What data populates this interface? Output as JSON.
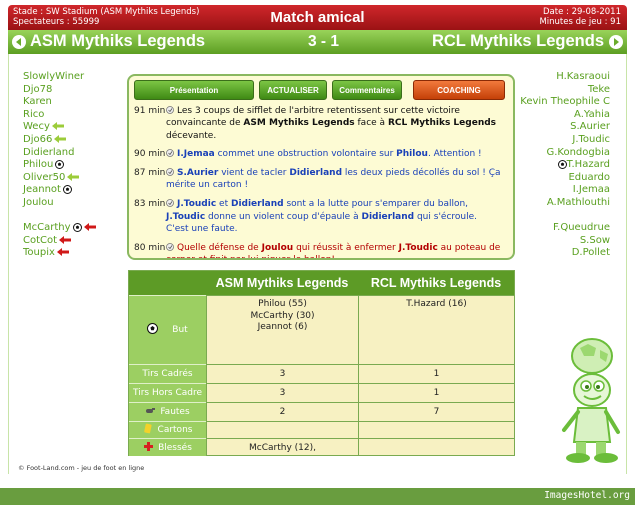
{
  "header": {
    "stadium": "Stade : SW Stadium (ASM Mythiks Legends)",
    "spectators": "Spectateurs : 55999",
    "title": "Match amical",
    "date": "Date : 29-08-2011",
    "minutes": "Minutes de jeu : 91"
  },
  "teams": {
    "home": "ASM Mythiks Legends",
    "away": "RCL Mythiks Legends",
    "score": "3 - 1"
  },
  "home_roster": [
    {
      "name": "SlowlyWiner",
      "marker": ""
    },
    {
      "name": "Djo78",
      "marker": ""
    },
    {
      "name": "Karen",
      "marker": ""
    },
    {
      "name": "Rico",
      "marker": ""
    },
    {
      "name": "Wecy",
      "marker": "sub-in"
    },
    {
      "name": "Djo66",
      "marker": "sub-in"
    },
    {
      "name": "Didierland",
      "marker": ""
    },
    {
      "name": "Philou",
      "marker": "goal"
    },
    {
      "name": "Oliver50",
      "marker": "sub-in"
    },
    {
      "name": "Jeannot",
      "marker": "goal"
    },
    {
      "name": "Joulou",
      "marker": ""
    },
    {
      "name": "",
      "marker": ""
    },
    {
      "name": "McCarthy",
      "marker": "goal-sub-out"
    },
    {
      "name": "CotCot",
      "marker": "sub-out"
    },
    {
      "name": "Toupix",
      "marker": "sub-out"
    }
  ],
  "away_roster": [
    {
      "name": "H.Kasraoui",
      "marker": ""
    },
    {
      "name": "Teke",
      "marker": ""
    },
    {
      "name": "Kevin Theophile C",
      "marker": ""
    },
    {
      "name": "A.Yahia",
      "marker": ""
    },
    {
      "name": "S.Aurier",
      "marker": ""
    },
    {
      "name": "J.Toudic",
      "marker": ""
    },
    {
      "name": "G.Kondogbia",
      "marker": ""
    },
    {
      "name": "T.Hazard",
      "marker": "goal"
    },
    {
      "name": "Eduardo",
      "marker": ""
    },
    {
      "name": "I.Jemaa",
      "marker": ""
    },
    {
      "name": "A.Mathlouthi",
      "marker": ""
    },
    {
      "name": "",
      "marker": ""
    },
    {
      "name": "F.Queudrue",
      "marker": ""
    },
    {
      "name": "S.Sow",
      "marker": ""
    },
    {
      "name": "D.Pollet",
      "marker": ""
    }
  ],
  "tabs": {
    "presentation": "Présentation",
    "refresh": "ACTUALISER",
    "comments": "Commentaires",
    "coaching": "COACHING"
  },
  "events": [
    {
      "minute": "91 min",
      "l1": [
        [
          "t-blk",
          "Les 3 coups de sifflet de l'arbitre retentissent sur cette victoire"
        ]
      ],
      "l2": [
        [
          "t-blk",
          "convaincante de "
        ],
        [
          "t-blk b",
          "ASM Mythiks Legends"
        ],
        [
          "t-blk",
          " face à "
        ],
        [
          "t-blk b",
          "RCL Mythiks Legends"
        ]
      ],
      "l3": [
        [
          "t-blk",
          "décevante."
        ]
      ]
    },
    {
      "minute": "90 min",
      "l1": [
        [
          "t-blue b",
          "I.Jemaa"
        ],
        [
          "t-blue",
          " commet une obstruction volontaire sur "
        ],
        [
          "t-blue b",
          "Philou"
        ],
        [
          "t-blue",
          ". Attention !"
        ]
      ],
      "l2": [],
      "l3": []
    },
    {
      "minute": "87 min",
      "l1": [
        [
          "t-blue b",
          "S.Aurier"
        ],
        [
          "t-blue",
          " vient de tacler "
        ],
        [
          "t-blue b",
          "Didierland"
        ],
        [
          "t-blue",
          " les deux pieds décollés du sol ! Ça"
        ]
      ],
      "l2": [
        [
          "t-blue",
          "mérite un carton !"
        ]
      ],
      "l3": []
    },
    {
      "minute": "83 min",
      "l1": [
        [
          "t-blue b",
          "J.Toudic"
        ],
        [
          "t-blue",
          " et "
        ],
        [
          "t-blue b",
          "Didierland"
        ],
        [
          "t-blue",
          " sont a la lutte pour s'emparer du ballon,"
        ]
      ],
      "l2": [
        [
          "t-blue b",
          "J.Toudic"
        ],
        [
          "t-blue",
          " donne un violent coup d'épaule à "
        ],
        [
          "t-blue b",
          "Didierland"
        ],
        [
          "t-blue",
          " qui s'écroule."
        ]
      ],
      "l3": [
        [
          "t-blue",
          "C'est une faute."
        ]
      ]
    },
    {
      "minute": "80 min",
      "l1": [
        [
          "t-red",
          "Quelle défense de "
        ],
        [
          "t-red b",
          "Joulou"
        ],
        [
          "t-red",
          " qui réussit à enfermer "
        ],
        [
          "t-red b",
          "J.Toudic"
        ],
        [
          "t-red",
          " au poteau de"
        ]
      ],
      "l2": [
        [
          "t-red",
          "corner et finit par lui piquer le ballon!"
        ]
      ],
      "l3": []
    }
  ],
  "stats": {
    "home_header": "ASM Mythiks Legends",
    "away_header": "RCL Mythiks Legends",
    "rows": [
      {
        "label": "But",
        "icon": "ball-icon",
        "home": [
          "Philou (55)",
          "McCarthy (30)",
          "Jeannot (6)"
        ],
        "away": [
          "T.Hazard (16)"
        ]
      },
      {
        "label": "Tirs Cadrés",
        "icon": "",
        "home": [
          "3"
        ],
        "away": [
          "1"
        ]
      },
      {
        "label": "Tirs Hors Cadre",
        "icon": "",
        "home": [
          "3"
        ],
        "away": [
          "1"
        ]
      },
      {
        "label": "Fautes",
        "icon": "whistle-icon",
        "home": [
          "2"
        ],
        "away": [
          "7"
        ]
      },
      {
        "label": "Cartons",
        "icon": "card-icon",
        "home": [
          ""
        ],
        "away": [
          ""
        ]
      },
      {
        "label": "Blessés",
        "icon": "cross-icon",
        "home": [
          "McCarthy (12),"
        ],
        "away": [
          ""
        ]
      }
    ]
  },
  "footer": "© Foot-Land.com - jeu de foot en ligne",
  "credit": "ImagesHotel.org",
  "colors": {
    "header_red": "#c0191d",
    "team_green": "#78b83c",
    "name_green": "#5aa020",
    "panel_bg": "#fdfbd4",
    "coaching_orange": "#e0601e"
  }
}
